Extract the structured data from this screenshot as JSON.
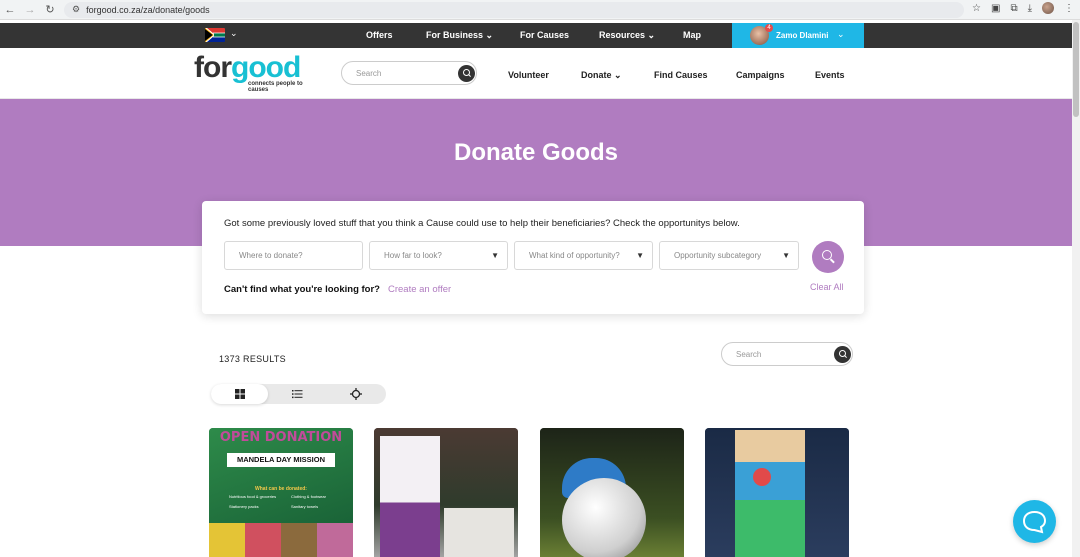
{
  "browser": {
    "url": "forgood.co.za/za/donate/goods"
  },
  "topbar": {
    "links": [
      "Offers",
      "For Business",
      "For Causes",
      "Resources",
      "Map"
    ],
    "user_name": "Zamo Dlamini",
    "notification_count": "4"
  },
  "nav": {
    "logo_for": "for",
    "logo_good": "good",
    "logo_tagline": "connects people to causes",
    "search_placeholder": "Search",
    "links": [
      "Volunteer",
      "Donate",
      "Find Causes",
      "Campaigns",
      "Events"
    ]
  },
  "hero": {
    "title": "Donate Goods"
  },
  "filter": {
    "intro": "Got some previously loved stuff that you think a Cause could use to help their beneficiaries? Check the opportunitys below.",
    "where_placeholder": "Where to donate?",
    "distance_placeholder": "How far to look?",
    "kind_placeholder": "What kind of opportunity?",
    "subcategory_placeholder": "Opportunity subcategory",
    "cant_find": "Can't find what you're looking for?",
    "create_offer": "Create an offer",
    "clear_all": "Clear All"
  },
  "results": {
    "count_label": "1373 RESULTS",
    "search_placeholder": "Search"
  },
  "cards": [
    {
      "headline": "OPEN DONATION",
      "banner": "MANDELA DAY MISSION",
      "sub": "What can be donated:",
      "items": [
        "Nutritious food & groceries",
        "Clothing & footwear",
        "Stationery packs",
        "Sanitary towels"
      ]
    },
    {
      "headline": "",
      "banner": ""
    },
    {
      "headline": "",
      "banner": ""
    },
    {
      "headline": "",
      "banner": ""
    }
  ],
  "colors": {
    "accent": "#b07cc0",
    "brand_cyan": "#1fb7e6",
    "topbar": "#343434"
  }
}
